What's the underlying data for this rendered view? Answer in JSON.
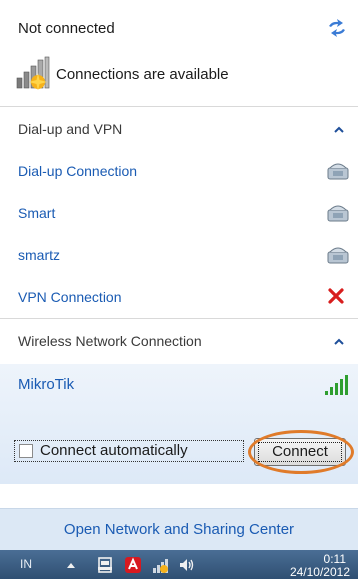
{
  "header": {
    "status": "Not connected",
    "connections_available": "Connections are available"
  },
  "sections": {
    "dialup": {
      "title": "Dial-up and VPN",
      "items": [
        {
          "label": "Dial-up Connection",
          "icon": "phone-modem-icon"
        },
        {
          "label": "Smart",
          "icon": "phone-modem-icon"
        },
        {
          "label": "smartz",
          "icon": "phone-modem-icon"
        },
        {
          "label": "VPN Connection",
          "icon": "red-x-icon"
        }
      ]
    },
    "wireless": {
      "title": "Wireless Network Connection",
      "network": {
        "name": "MikroTik",
        "connect_automatically": "Connect automatically",
        "connect_button": "Connect"
      }
    }
  },
  "footer": {
    "open_center": "Open Network and Sharing Center"
  },
  "taskbar": {
    "language": "IN",
    "time": "0:11",
    "date": "24/10/2012"
  },
  "colors": {
    "link": "#1a5bb3",
    "highlight": "#e07b2a",
    "taskbar": "#3a5d84",
    "selected_bg": "#e4eefa"
  }
}
